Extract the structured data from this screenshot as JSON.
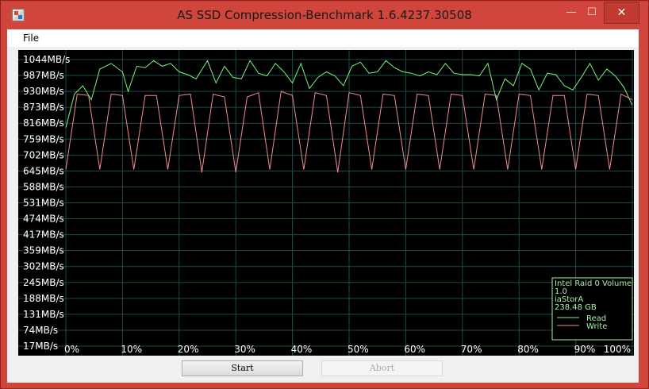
{
  "window": {
    "title": "AS SSD Compression-Benchmark 1.6.4237.30508",
    "controls": {
      "minimize": "—",
      "maximize": "☐",
      "close": "✕"
    }
  },
  "menu": {
    "file": "File"
  },
  "buttons": {
    "start": "Start",
    "abort": "Abort"
  },
  "colors": {
    "read": "#7cf27c",
    "write": "#f08c8c",
    "grid": "#1f4b4b",
    "legend_text": "#a8f0a8"
  },
  "chart_data": {
    "type": "line",
    "y_ticks": [
      "1044MB/s",
      "987MB/s",
      "930MB/s",
      "873MB/s",
      "816MB/s",
      "759MB/s",
      "702MB/s",
      "645MB/s",
      "588MB/s",
      "531MB/s",
      "474MB/s",
      "417MB/s",
      "359MB/s",
      "302MB/s",
      "245MB/s",
      "188MB/s",
      "131MB/s",
      "74MB/s",
      "17MB/s"
    ],
    "x_ticks": [
      "0%",
      "10%",
      "20%",
      "30%",
      "40%",
      "50%",
      "60%",
      "70%",
      "80%",
      "90%",
      "100%"
    ],
    "ylim": [
      17,
      1044
    ],
    "xlim": [
      0,
      100
    ],
    "legend": {
      "device": "Intel Raid 0 Volume",
      "version": "1.0",
      "driver": "iaStorA",
      "size": "238.48 GB"
    },
    "series": [
      {
        "name": "Read",
        "x": [
          0,
          1.5,
          3,
          4.5,
          6,
          8,
          10,
          11,
          12.5,
          14,
          15.5,
          17,
          18.5,
          20,
          21.5,
          23,
          25,
          26.5,
          28,
          29.5,
          31,
          32.5,
          34,
          35.5,
          37,
          38.5,
          40,
          41.5,
          43,
          44.5,
          46,
          47.5,
          49,
          50.5,
          52,
          53.5,
          55,
          56.5,
          58,
          59.5,
          61,
          62.5,
          64,
          65.5,
          67,
          68.5,
          70,
          71.5,
          73,
          74.5,
          76,
          77.5,
          79,
          80.5,
          82,
          83.5,
          85,
          86.5,
          88,
          89.5,
          91,
          92.5,
          94,
          95.5,
          97,
          98.5,
          100
        ],
        "values": [
          800,
          920,
          950,
          900,
          1010,
          1030,
          1000,
          930,
          1020,
          1015,
          1040,
          1020,
          1030,
          1000,
          990,
          975,
          1040,
          960,
          1020,
          980,
          975,
          1040,
          995,
          985,
          1030,
          1000,
          960,
          1030,
          940,
          980,
          1000,
          985,
          950,
          1020,
          1035,
          995,
          1000,
          1040,
          1015,
          1000,
          995,
          985,
          1000,
          990,
          1030,
          995,
          990,
          990,
          985,
          1030,
          900,
          975,
          950,
          1030,
          1010,
          935,
          995,
          990,
          950,
          935,
          980,
          1030,
          970,
          1010,
          985,
          945,
          880
        ]
      },
      {
        "name": "Write",
        "x": [
          0,
          2,
          4,
          6,
          8,
          10,
          12,
          14,
          16,
          18,
          20,
          22,
          24,
          26,
          28,
          30,
          32,
          34,
          36,
          38,
          40,
          42,
          44,
          46,
          48,
          50,
          52,
          54,
          56,
          58,
          60,
          62,
          64,
          66,
          68,
          70,
          72,
          74,
          76,
          78,
          80,
          82,
          84,
          86,
          88,
          90,
          92,
          94,
          96,
          98,
          100
        ],
        "values": [
          650,
          920,
          915,
          650,
          920,
          915,
          650,
          915,
          915,
          650,
          915,
          920,
          640,
          920,
          910,
          640,
          910,
          925,
          650,
          930,
          915,
          650,
          925,
          915,
          640,
          925,
          915,
          650,
          920,
          915,
          650,
          920,
          915,
          650,
          920,
          915,
          650,
          920,
          915,
          650,
          920,
          915,
          650,
          915,
          915,
          650,
          920,
          915,
          650,
          920,
          900
        ]
      }
    ]
  }
}
